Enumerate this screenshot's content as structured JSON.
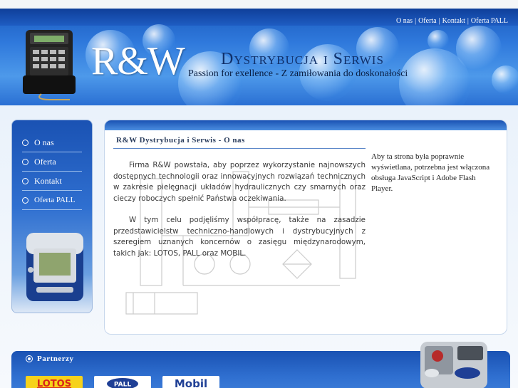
{
  "header": {
    "top_nav": [
      {
        "label": "O nas"
      },
      {
        "label": "Oferta"
      },
      {
        "label": "Kontakt"
      },
      {
        "label": "Oferta PALL"
      }
    ],
    "logo_text": "R&W",
    "company_name": "Dystrybucja i Serwis",
    "slogan": "Passion for exellence - Z zamiłowania do doskonałości"
  },
  "sidebar": {
    "items": [
      {
        "label": "O nas"
      },
      {
        "label": "Oferta"
      },
      {
        "label": "Kontakt"
      },
      {
        "label": "Oferta PALL"
      }
    ]
  },
  "content": {
    "title": "R&W Dystrybucja i Serwis - O nas",
    "paragraphs": [
      "Firma R&W powstała, aby poprzez wykorzystanie najnowszych dostępnych technologii oraz innowacyjnych rozwiązań technicznych w zakresie pielęgnacji układów hydraulicznych czy smarnych oraz cieczy roboczych spełnić Państwa oczekiwania.",
      "W tym celu podjęliśmy współpracę, także na zasadzie przedstawicielstw techniczno-handlowych i dystrybucyjnych z szeregiem uznanych koncernów o zasięgu międzynarodowym, takich jak: LOTOS, PALL oraz MOBIL."
    ],
    "flash_note": "Aby ta strona była poprawnie wyświetlana, potrzebna jest włączona obsługa JavaScript i Adobe Flash Player."
  },
  "partners": {
    "label": "Partnerzy",
    "logos": [
      {
        "name": "LOTOS",
        "text": "LOTOS"
      },
      {
        "name": "PALL",
        "text": "PALL"
      },
      {
        "name": "Mobil",
        "text": "Mobil"
      }
    ]
  },
  "colors": {
    "brand_blue": "#1a52b3",
    "header_light": "#4d99ea",
    "title_text": "#2a3c5c",
    "lotos_yellow": "#f6d21c",
    "lotos_red": "#d8261c",
    "mobil_blue": "#1f3f95"
  }
}
